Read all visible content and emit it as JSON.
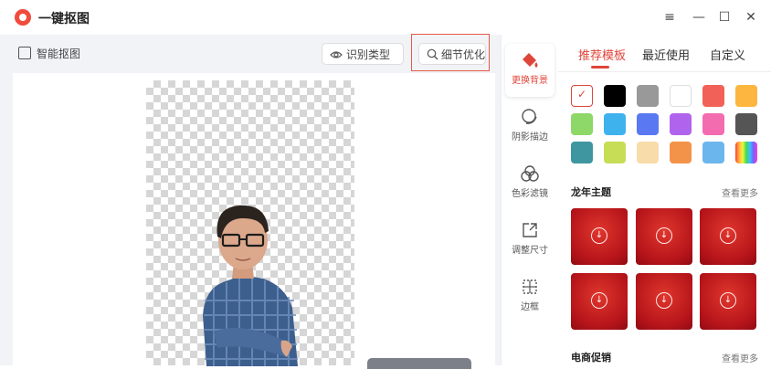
{
  "window": {
    "title": "一键抠图",
    "controls": {
      "menu": "≡",
      "minimize": "—",
      "maximize": "☐",
      "close": "✕"
    }
  },
  "left_toolbar": {
    "smart_cutout_label": "智能抠图",
    "recognition_type_label": "识别类型",
    "detail_optimize_label": "细节优化"
  },
  "tools": [
    {
      "label": "更换背景",
      "icon": "paint-bucket-icon",
      "active": true
    },
    {
      "label": "阴影描边",
      "icon": "shadow-icon"
    },
    {
      "label": "色彩滤镜",
      "icon": "color-filter-icon"
    },
    {
      "label": "调整尺寸",
      "icon": "resize-icon"
    },
    {
      "label": "边框",
      "icon": "border-icon"
    }
  ],
  "tabs": [
    {
      "label": "推荐模板",
      "active": true
    },
    {
      "label": "最近使用"
    },
    {
      "label": "自定义"
    }
  ],
  "colors": [
    "selected",
    "#000000",
    "#999999",
    "#ffffff",
    "#f26157",
    "#fdb640",
    "#8ed86a",
    "#3eb2ed",
    "#5978f2",
    "#b064ed",
    "#f46cb0",
    "#555555",
    "#3f96a0",
    "#c6dd55",
    "#f8dcaa",
    "#f3934a",
    "#6cb6ee",
    "rainbow"
  ],
  "sections": {
    "dragon": {
      "title": "龙年主题",
      "see_more": "查看更多"
    },
    "ecommerce": {
      "title": "电商促销",
      "see_more": "查看更多"
    }
  },
  "accent": "#e0453a"
}
